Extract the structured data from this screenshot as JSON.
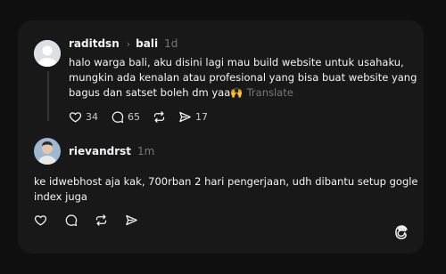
{
  "post": {
    "username": "raditdsn",
    "topic": "bali",
    "time": "1d",
    "line1": "halo warga bali, aku disini lagi mau build website untuk usahaku,",
    "line2": "mungkin ada kenalan atau profesional yang bisa buat website yang",
    "line3": "bagus dan satset boleh dm yaa🙌",
    "translate": "Translate",
    "likes": "34",
    "comments": "65",
    "shares": "17"
  },
  "reply": {
    "username": "rievandrst",
    "time": "1m",
    "line1": "ke idwebhost aja kak, 700rban 2 hari pengerjaan, udh dibantu setup gogle",
    "line2": "index juga"
  }
}
